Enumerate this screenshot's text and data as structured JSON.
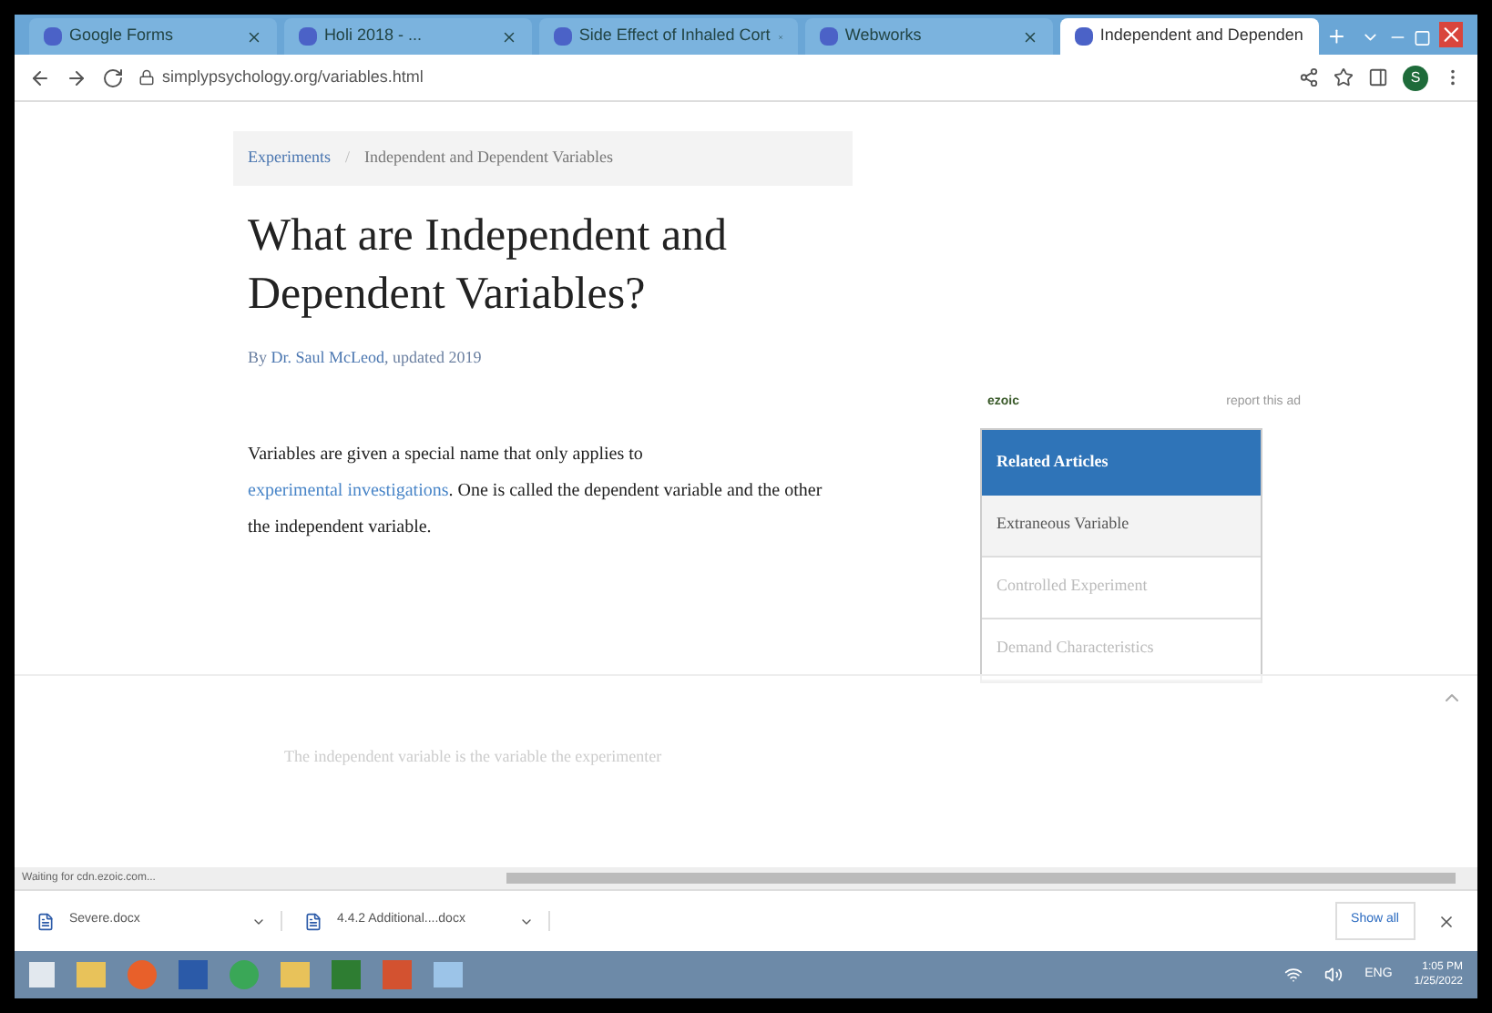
{
  "tabs": [
    {
      "title": "Google Forms",
      "selected": false
    },
    {
      "title": "Holi 2018 - ...",
      "selected": false
    },
    {
      "title": "Side Effect of Inhaled Cort",
      "selected": false
    },
    {
      "title": "Webworks",
      "selected": false
    },
    {
      "title": "Independent and Dependen",
      "selected": true
    }
  ],
  "address": "simplypsychology.org/variables.html",
  "profile_initial": "S",
  "breadcrumb": {
    "link": "Experiments",
    "separator": "/",
    "current": "Independent and Dependent Variables"
  },
  "title": "What are Independent and Dependent Variables?",
  "byline": {
    "prefix": "By ",
    "author": "Dr. Saul McLeod",
    "suffix": ", updated 2019"
  },
  "paragraph": {
    "before": "Variables are given a special name that only applies to ",
    "link": "experimental investigations",
    "after": ". One is called the dependent variable and the other the independent variable."
  },
  "faded_paragraph": "The independent variable is the variable the experimenter",
  "ad": {
    "brand": "ezoic",
    "report": "report this ad"
  },
  "related": {
    "heading": "Related Articles",
    "items": [
      "Extraneous Variable",
      "Controlled Experiment",
      "Demand Characteristics"
    ]
  },
  "status": "Waiting for cdn.ezoic.com...",
  "downloads": [
    {
      "name": "Severe.docx"
    },
    {
      "name": "4.4.2 Additional....docx"
    }
  ],
  "show_all": "Show all",
  "tray": {
    "lang": "ENG",
    "time": "1:05 PM",
    "date": "1/25/2022"
  }
}
